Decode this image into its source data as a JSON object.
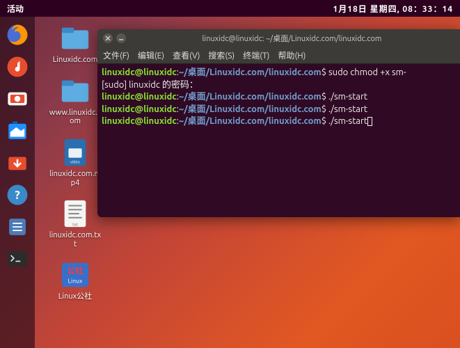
{
  "topbar": {
    "activities": "活动",
    "clock": "1月18日 星期四, 08：33：14"
  },
  "launcher": [
    {
      "name": "firefox-icon"
    },
    {
      "name": "music-icon"
    },
    {
      "name": "camera-icon"
    },
    {
      "name": "files-icon"
    },
    {
      "name": "software-icon"
    },
    {
      "name": "help-icon"
    },
    {
      "name": "todo-icon"
    },
    {
      "name": "terminal-icon"
    }
  ],
  "desktop_icons": [
    {
      "label": "Linuxidc.com",
      "type": "folder"
    },
    {
      "label": "www.linuxidc.com",
      "type": "folder"
    },
    {
      "label": "linuxidc.com.mp4",
      "type": "video"
    },
    {
      "label": "linuxidc.com.txt",
      "type": "text"
    },
    {
      "label": "Linux公社",
      "type": "image"
    }
  ],
  "terminal": {
    "title": "linuxidc@linuxidc: ~/桌面/Linuxidc.com/linuxidc.com",
    "menus": {
      "file": "文件(F)",
      "edit": "编辑(E)",
      "view": "查看(V)",
      "search": "搜索(S)",
      "terminal": "终端(T)",
      "help": "帮助(H)"
    },
    "prompt_user": "linuxidc@linuxidc",
    "prompt_path": "~/桌面/Linuxidc.com/linuxidc.com",
    "lines": {
      "cmd1": " sudo chmod +x sm-",
      "sudo_text": "[sudo] linuxidc 的密码：",
      "cmd2": " ./sm-start",
      "cmd3": " ./sm-start",
      "cmd4": " ./sm-start"
    }
  }
}
